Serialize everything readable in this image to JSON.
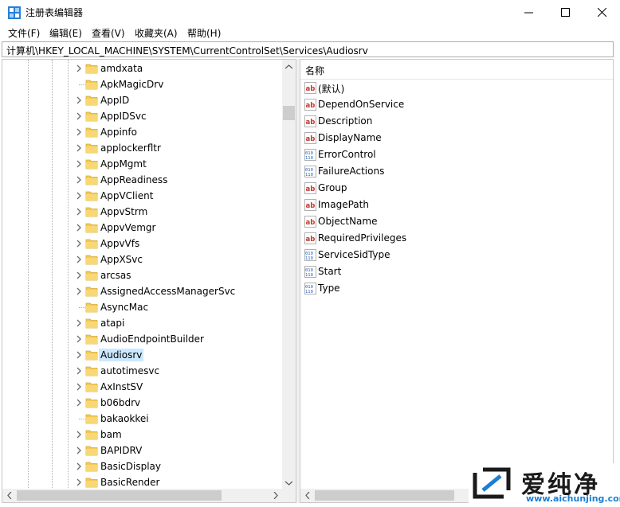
{
  "window": {
    "title": "注册表编辑器"
  },
  "menu": [
    "文件(F)",
    "编辑(E)",
    "查看(V)",
    "收藏夹(A)",
    "帮助(H)"
  ],
  "address": "计算机\\HKEY_LOCAL_MACHINE\\SYSTEM\\CurrentControlSet\\Services\\Audiosrv",
  "tree": {
    "selected": "Audiosrv",
    "items": [
      {
        "label": "amdxata",
        "expandable": true
      },
      {
        "label": "ApkMagicDrv",
        "expandable": false
      },
      {
        "label": "AppID",
        "expandable": true
      },
      {
        "label": "AppIDSvc",
        "expandable": true
      },
      {
        "label": "Appinfo",
        "expandable": true
      },
      {
        "label": "applockerfltr",
        "expandable": true
      },
      {
        "label": "AppMgmt",
        "expandable": true
      },
      {
        "label": "AppReadiness",
        "expandable": true
      },
      {
        "label": "AppVClient",
        "expandable": true
      },
      {
        "label": "AppvStrm",
        "expandable": true
      },
      {
        "label": "AppvVemgr",
        "expandable": true
      },
      {
        "label": "AppvVfs",
        "expandable": true
      },
      {
        "label": "AppXSvc",
        "expandable": true
      },
      {
        "label": "arcsas",
        "expandable": true
      },
      {
        "label": "AssignedAccessManagerSvc",
        "expandable": true
      },
      {
        "label": "AsyncMac",
        "expandable": false
      },
      {
        "label": "atapi",
        "expandable": true
      },
      {
        "label": "AudioEndpointBuilder",
        "expandable": true
      },
      {
        "label": "Audiosrv",
        "expandable": true
      },
      {
        "label": "autotimesvc",
        "expandable": true
      },
      {
        "label": "AxInstSV",
        "expandable": true
      },
      {
        "label": "b06bdrv",
        "expandable": true
      },
      {
        "label": "bakaokkei",
        "expandable": false
      },
      {
        "label": "bam",
        "expandable": true
      },
      {
        "label": "BAPIDRV",
        "expandable": true
      },
      {
        "label": "BasicDisplay",
        "expandable": true
      },
      {
        "label": "BasicRender",
        "expandable": true
      }
    ]
  },
  "values": {
    "column_name": "名称",
    "items": [
      {
        "name": "(默认)",
        "type": "sz"
      },
      {
        "name": "DependOnService",
        "type": "sz"
      },
      {
        "name": "Description",
        "type": "sz"
      },
      {
        "name": "DisplayName",
        "type": "sz"
      },
      {
        "name": "ErrorControl",
        "type": "dword"
      },
      {
        "name": "FailureActions",
        "type": "dword"
      },
      {
        "name": "Group",
        "type": "sz"
      },
      {
        "name": "ImagePath",
        "type": "sz"
      },
      {
        "name": "ObjectName",
        "type": "sz"
      },
      {
        "name": "RequiredPrivileges",
        "type": "sz"
      },
      {
        "name": "ServiceSidType",
        "type": "dword"
      },
      {
        "name": "Start",
        "type": "dword"
      },
      {
        "name": "Type",
        "type": "dword"
      }
    ]
  },
  "watermark": {
    "cn": "爱纯净",
    "url": "www.aichunjing.com"
  },
  "colors": {
    "folder": "#f3c957",
    "selection": "#cce8ff",
    "sz_icon": "#c0392b",
    "dword_icon": "#1f5fbf",
    "watermark_url": "#1a7fd4"
  }
}
